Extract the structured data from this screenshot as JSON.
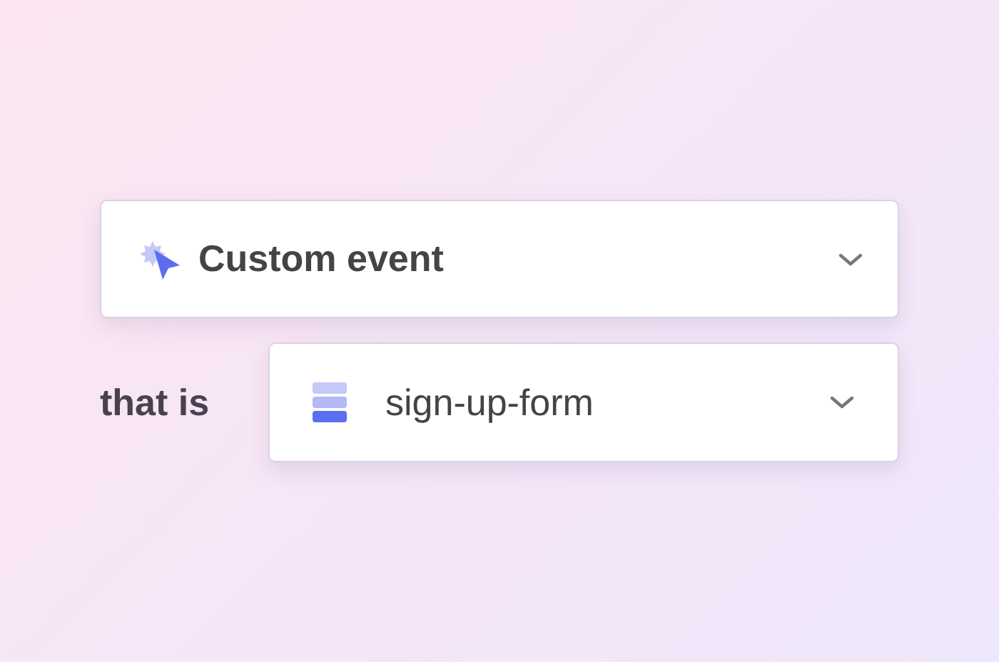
{
  "event_select": {
    "value": "Custom event"
  },
  "filter": {
    "label": "that is",
    "value": "sign-up-form"
  }
}
